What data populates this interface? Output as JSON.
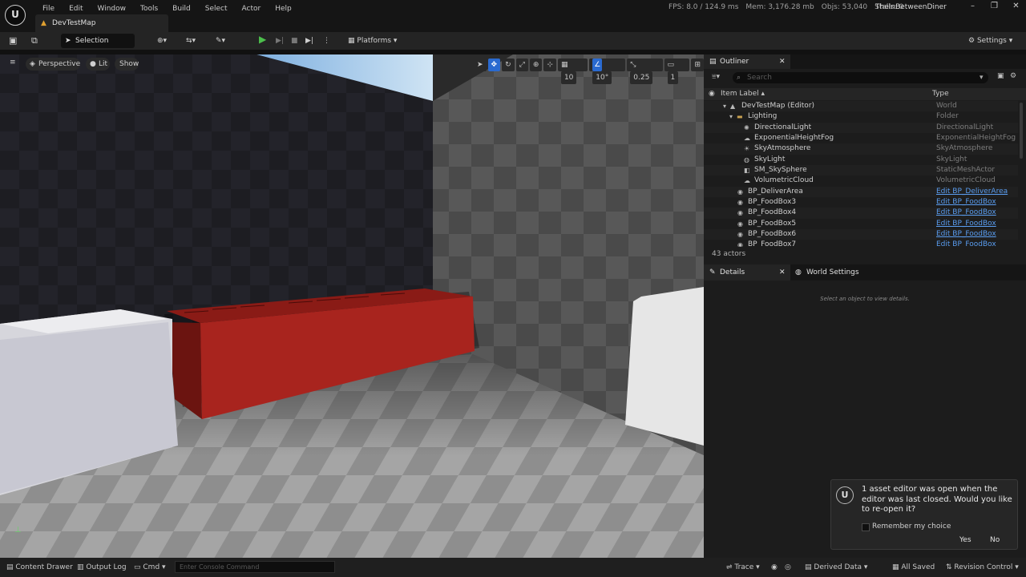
{
  "app": {
    "logo": "U",
    "project": "TheInBetweenDiner"
  },
  "menu": [
    "File",
    "Edit",
    "Window",
    "Tools",
    "Build",
    "Select",
    "Actor",
    "Help"
  ],
  "map_tab": "DevTestMap",
  "stats": {
    "fps": "FPS: 8.0",
    "ms": "/ 124.9 ms",
    "mem": "Mem: 3,176.28 mb",
    "objs": "Objs: 53,040",
    "stalls": "Stalls: 0"
  },
  "toolbar": {
    "selection_mode": "Selection Mode",
    "platforms": "Platforms",
    "settings": "Settings"
  },
  "viewport": {
    "perspective": "Perspective",
    "lit": "Lit",
    "show": "Show",
    "grid": "10",
    "angle": "10°",
    "scale": "0.25",
    "cams": "1"
  },
  "outliner": {
    "tab": "Outliner",
    "search_placeholder": "Search",
    "col_label": "Item Label",
    "col_type": "Type",
    "rows": [
      {
        "label": "DevTestMap (Editor)",
        "type": "World",
        "link": false
      },
      {
        "label": "Lighting",
        "type": "Folder",
        "link": false
      },
      {
        "label": "DirectionalLight",
        "type": "DirectionalLight",
        "link": false
      },
      {
        "label": "ExponentialHeightFog",
        "type": "ExponentialHeightFog",
        "link": false
      },
      {
        "label": "SkyAtmosphere",
        "type": "SkyAtmosphere",
        "link": false
      },
      {
        "label": "SkyLight",
        "type": "SkyLight",
        "link": false
      },
      {
        "label": "SM_SkySphere",
        "type": "StaticMeshActor",
        "link": false
      },
      {
        "label": "VolumetricCloud",
        "type": "VolumetricCloud",
        "link": false
      },
      {
        "label": "BP_DeliverArea",
        "type": "Edit BP_DeliverArea",
        "link": true
      },
      {
        "label": "BP_FoodBox3",
        "type": "Edit BP_FoodBox",
        "link": true
      },
      {
        "label": "BP_FoodBox4",
        "type": "Edit BP_FoodBox",
        "link": true
      },
      {
        "label": "BP_FoodBox5",
        "type": "Edit BP_FoodBox",
        "link": true
      },
      {
        "label": "BP_FoodBox6",
        "type": "Edit BP_FoodBox",
        "link": true
      },
      {
        "label": "BP_FoodBox7",
        "type": "Edit BP_FoodBox",
        "link": true
      }
    ],
    "count": "43 actors"
  },
  "details": {
    "tab": "Details",
    "world_tab": "World Settings",
    "empty": "Select an object to view details."
  },
  "toast": {
    "message": "1 asset editor was open when the editor was last closed. Would you like to re-open it?",
    "remember": "Remember my choice",
    "yes": "Yes",
    "no": "No"
  },
  "statusbar": {
    "content_drawer": "Content Drawer",
    "output_log": "Output Log",
    "cmd": "Cmd",
    "console_placeholder": "Enter Console Command",
    "trace": "Trace",
    "derived_data": "Derived Data",
    "all_saved": "All Saved",
    "revision_control": "Revision Control"
  }
}
